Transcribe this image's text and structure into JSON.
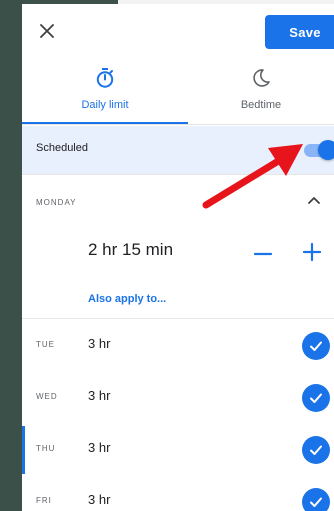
{
  "header": {
    "save_label": "Save"
  },
  "tabs": [
    {
      "label": "Daily limit",
      "icon": "timer-icon",
      "active": true
    },
    {
      "label": "Bedtime",
      "icon": "moon-icon",
      "active": false
    }
  ],
  "scheduled": {
    "label": "Scheduled",
    "enabled": true
  },
  "monday": {
    "day": "MONDAY",
    "time": "2 hr 15 min",
    "apply_link": "Also apply to..."
  },
  "days": [
    {
      "day": "TUE",
      "value": "3 hr",
      "checked": true
    },
    {
      "day": "WED",
      "value": "3 hr",
      "checked": true
    },
    {
      "day": "THU",
      "value": "3 hr",
      "checked": true
    },
    {
      "day": "FRI",
      "value": "3 hr",
      "checked": true
    }
  ],
  "colors": {
    "accent": "#1a73e8",
    "annotation_arrow": "#e8141b",
    "scheduled_bg": "#e8f0fd"
  }
}
